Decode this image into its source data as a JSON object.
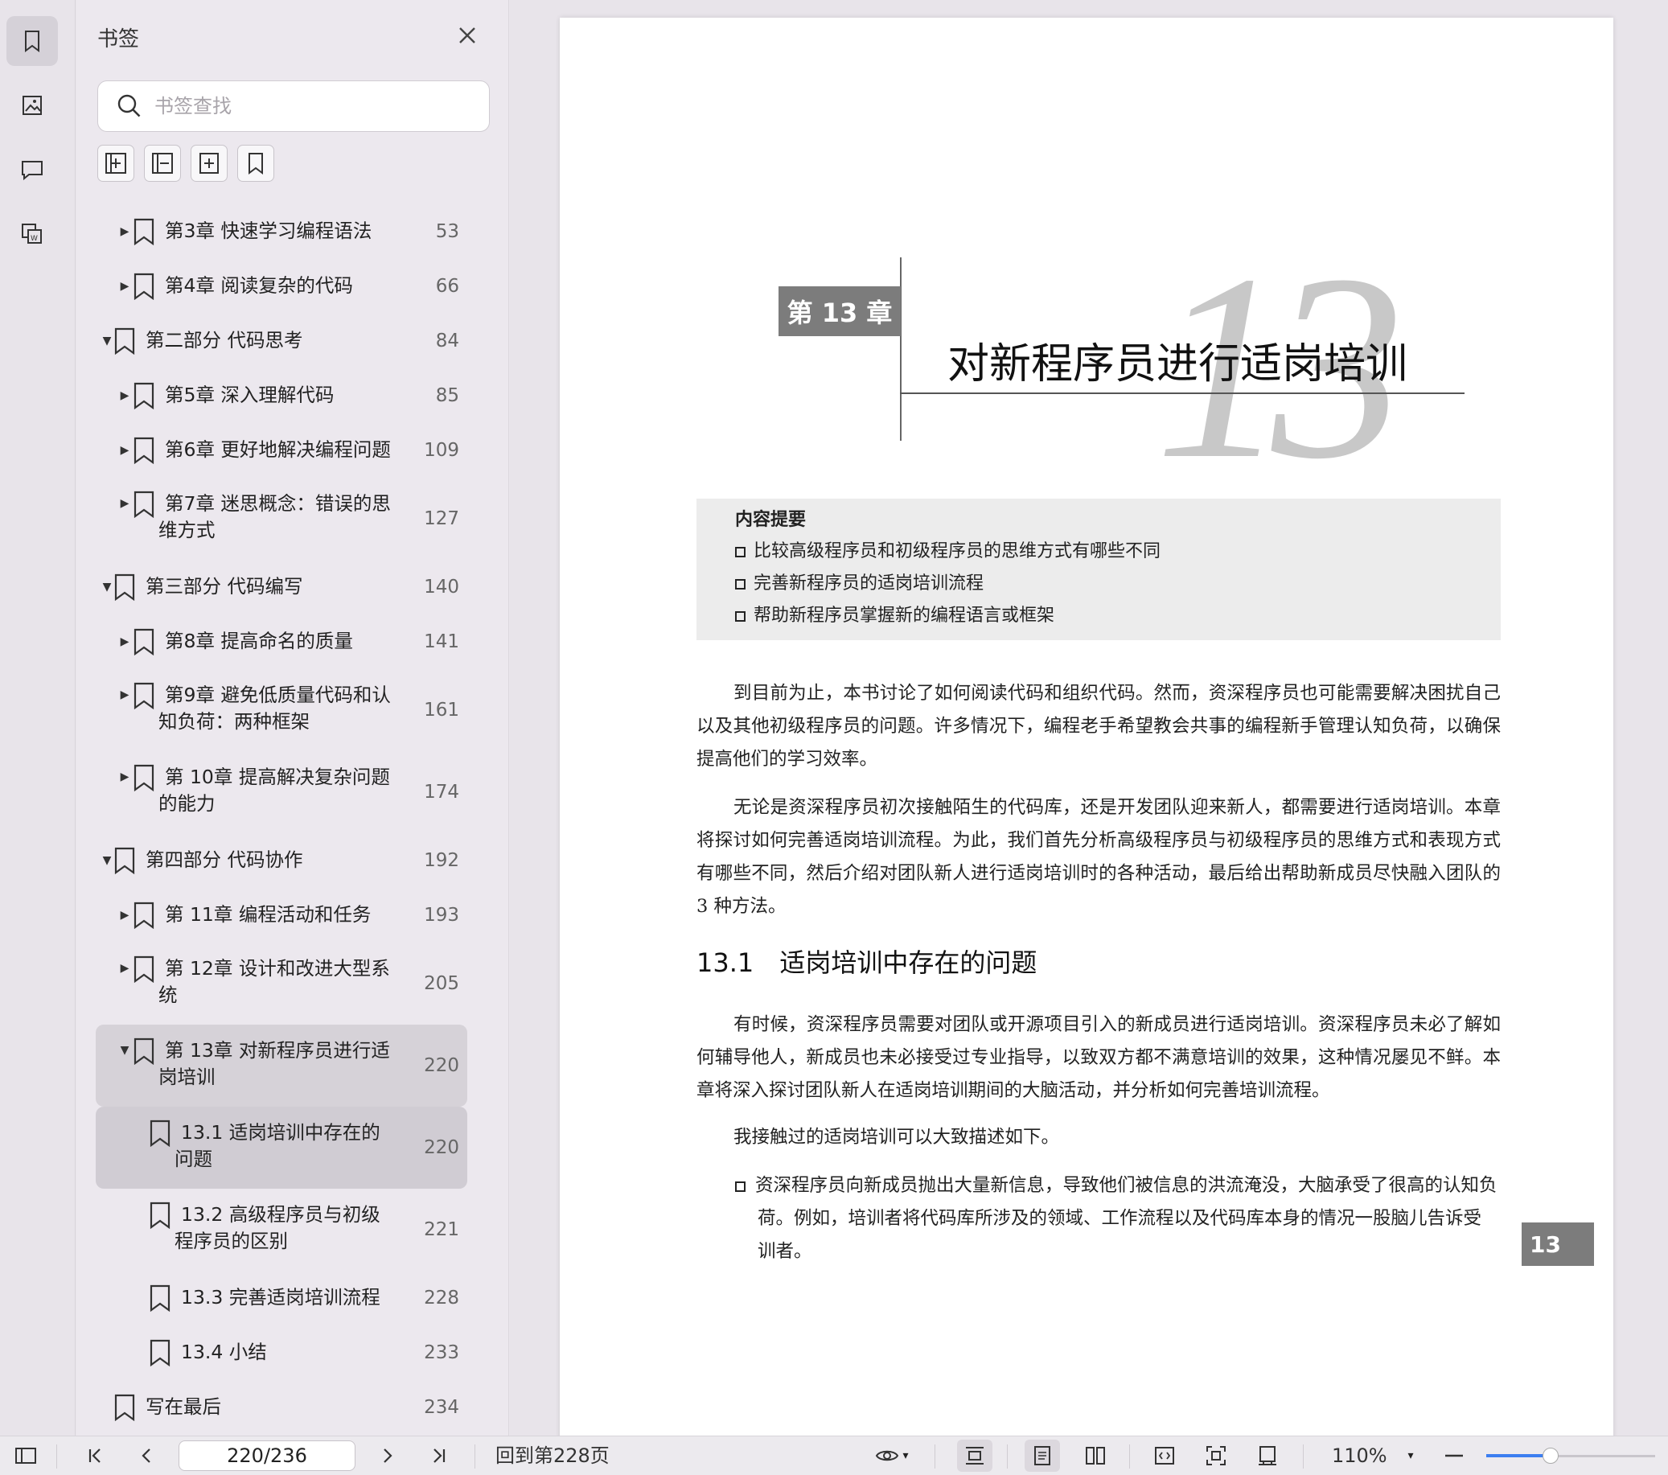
{
  "sidebar": {
    "title": "书签",
    "search_placeholder": "书签查找",
    "tree": [
      {
        "label": [
          "第3章 快速学习编程语法"
        ],
        "page": "53",
        "level": 2,
        "arrow": "right"
      },
      {
        "label": [
          "第4章 阅读复杂的代码"
        ],
        "page": "66",
        "level": 2,
        "arrow": "right"
      },
      {
        "label": [
          "第二部分 代码思考"
        ],
        "page": "84",
        "level": 1,
        "arrow": "down"
      },
      {
        "label": [
          "第5章 深入理解代码"
        ],
        "page": "85",
        "level": 2,
        "arrow": "right"
      },
      {
        "label": [
          "第6章 更好地解决编程问题"
        ],
        "page": "109",
        "level": 2,
        "arrow": "right"
      },
      {
        "label": [
          "第7章 迷思概念：错误的思",
          "维方式"
        ],
        "page": "127",
        "level": 2,
        "arrow": "right"
      },
      {
        "label": [
          "第三部分 代码编写"
        ],
        "page": "140",
        "level": 1,
        "arrow": "down"
      },
      {
        "label": [
          "第8章 提高命名的质量"
        ],
        "page": "141",
        "level": 2,
        "arrow": "right"
      },
      {
        "label": [
          "第9章 避免低质量代码和认",
          "知负荷：两种框架"
        ],
        "page": "161",
        "level": 2,
        "arrow": "right"
      },
      {
        "label": [
          "第 10章 提高解决复杂问题",
          "的能力"
        ],
        "page": "174",
        "level": 2,
        "arrow": "right"
      },
      {
        "label": [
          "第四部分 代码协作"
        ],
        "page": "192",
        "level": 1,
        "arrow": "down"
      },
      {
        "label": [
          "第 11章 编程活动和任务"
        ],
        "page": "193",
        "level": 2,
        "arrow": "right"
      },
      {
        "label": [
          "第 12章 设计和改进大型系",
          "统"
        ],
        "page": "205",
        "level": 2,
        "arrow": "right"
      },
      {
        "label": [
          "第 13章 对新程序员进行适",
          "岗培训"
        ],
        "page": "220",
        "level": 2,
        "arrow": "down",
        "state": "expanded-selected"
      },
      {
        "label": [
          "13.1 适岗培训中存在的",
          "问题"
        ],
        "page": "220",
        "level": 3,
        "arrow": "",
        "state": "current"
      },
      {
        "label": [
          "13.2 高级程序员与初级",
          "程序员的区别"
        ],
        "page": "221",
        "level": 3,
        "arrow": ""
      },
      {
        "label": [
          "13.3 完善适岗培训流程"
        ],
        "page": "228",
        "level": 3,
        "arrow": ""
      },
      {
        "label": [
          "13.4 小结"
        ],
        "page": "233",
        "level": 3,
        "arrow": ""
      },
      {
        "label": [
          "写在最后"
        ],
        "page": "234",
        "level": 1,
        "arrow": ""
      }
    ]
  },
  "document": {
    "chapter_badge": "第 13 章",
    "chapter_big_number": "13",
    "chapter_title": "对新程序员进行适岗培训",
    "summary_heading": "内容提要",
    "summary_items": [
      "比较高级程序员和初级程序员的思维方式有哪些不同",
      "完善新程序员的适岗培训流程",
      "帮助新程序员掌握新的编程语言或框架"
    ],
    "para1": "到目前为止，本书讨论了如何阅读代码和组织代码。然而，资深程序员也可能需要解决困扰自己以及其他初级程序员的问题。许多情况下，编程老手希望教会共事的编程新手管理认知负荷，以确保提高他们的学习效率。",
    "para2": "无论是资深程序员初次接触陌生的代码库，还是开发团队迎来新人，都需要进行适岗培训。本章将探讨如何完善适岗培训流程。为此，我们首先分析高级程序员与初级程序员的思维方式和表现方式有哪些不同，然后介绍对团队新人进行适岗培训时的各种活动，最后给出帮助新成员尽快融入团队的 3 种方法。",
    "section_title": "13.1 适岗培训中存在的问题",
    "para3": "有时候，资深程序员需要对团队或开源项目引入的新成员进行适岗培训。资深程序员未必了解如何辅导他人，新成员也未必接受过专业指导，以致双方都不满意培训的效果，这种情况屡见不鲜。本章将深入探讨团队新人在适岗培训期间的大脑活动，并分析如何完善培训流程。",
    "para4": "我接触过的适岗培训可以大致描述如下。",
    "bullet1": "资深程序员向新成员抛出大量新信息，导致他们被信息的洪流淹没，大脑承受了很高的认知负荷。例如，培训者将代码库所涉及的领域、工作流程以及代码库本身的情况一股脑儿告诉受训者。",
    "page_tab": "13"
  },
  "toolbar": {
    "page_indicator": "220/236",
    "goto_label": "回到第228页",
    "zoom": "110%",
    "zoom_slider_fraction": 0.38
  }
}
